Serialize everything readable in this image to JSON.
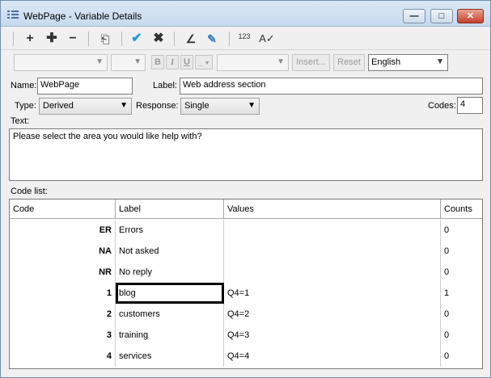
{
  "window": {
    "title": "WebPage - Variable Details",
    "min_glyph": "—",
    "max_glyph": "□",
    "close_glyph": "✕"
  },
  "toolbar": {
    "add_icon": "+",
    "insert_icon": "✚",
    "remove_icon": "−",
    "import_icon": "⎗",
    "ok_icon": "✔",
    "cancel_icon": "✖",
    "chart_icon": "∠",
    "tools_icon": "✎",
    "numbering_label": "123",
    "spell_icon": "A✓"
  },
  "formatbar": {
    "bold": "B",
    "italic": "I",
    "underline": "U",
    "line": "_",
    "insert_label": "Insert...",
    "reset_label": "Reset",
    "language": "English"
  },
  "form": {
    "name_label": "Name:",
    "name_value": "WebPage",
    "label_label": "Label:",
    "label_value": "Web address section",
    "type_label": "Type:",
    "type_value": "Derived",
    "response_label": "Response:",
    "response_value": "Single",
    "codes_label": "Codes:",
    "codes_value": "4",
    "text_label": "Text:",
    "text_value": "Please select the area you would like help with?",
    "codelist_label": "Code list:"
  },
  "table": {
    "headers": [
      "Code",
      "Label",
      "Values",
      "Counts"
    ],
    "rows": [
      {
        "code": "ER",
        "label": "Errors",
        "values": "",
        "counts": "0"
      },
      {
        "code": "NA",
        "label": "Not asked",
        "values": "",
        "counts": "0"
      },
      {
        "code": "NR",
        "label": "No reply",
        "values": "",
        "counts": "0"
      },
      {
        "code": "1",
        "label": "blog",
        "values": "Q4=1",
        "counts": "1"
      },
      {
        "code": "2",
        "label": "customers",
        "values": "Q4=2",
        "counts": "0"
      },
      {
        "code": "3",
        "label": "training",
        "values": "Q4=3",
        "counts": "0"
      },
      {
        "code": "4",
        "label": "services",
        "values": "Q4=4",
        "counts": "0"
      }
    ]
  },
  "colors": {
    "accent": "#1f9bd7",
    "window_border": "#6f8fb0",
    "close_button": "#c5412a"
  }
}
